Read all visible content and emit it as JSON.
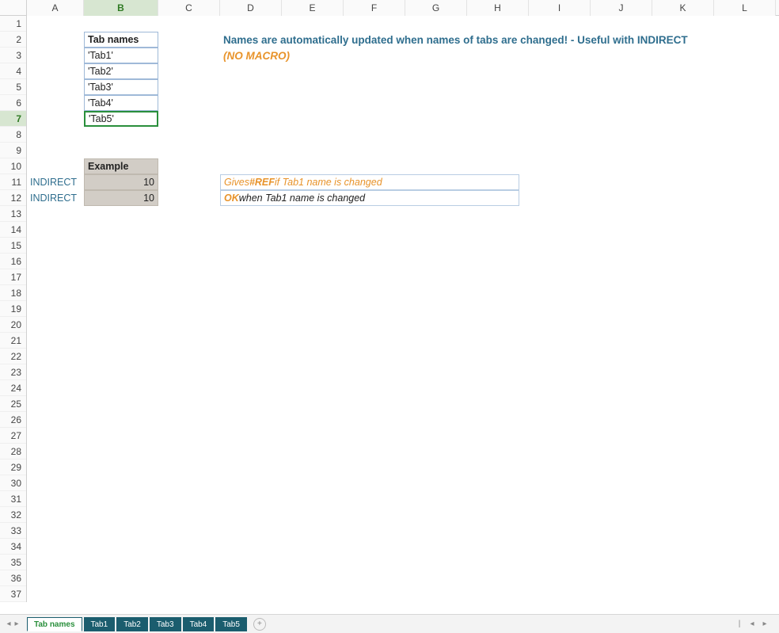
{
  "columns": [
    "A",
    "B",
    "C",
    "D",
    "E",
    "F",
    "G",
    "H",
    "I",
    "J",
    "K",
    "L"
  ],
  "selectedColumn": "B",
  "rows": 37,
  "selectedRow": 7,
  "tabNames": {
    "header": "Tab names",
    "items": [
      "'Tab1'",
      "'Tab2'",
      "'Tab3'",
      "'Tab4'",
      "'Tab5'"
    ]
  },
  "headline": "Names are automatically updated when names of tabs are changed! - Useful with INDIRECT",
  "subheadline": "(NO MACRO)",
  "example": {
    "header": "Example",
    "rows": [
      {
        "label": "INDIRECT",
        "value": "10",
        "note_prefix": "Gives ",
        "note_accent": "#REF",
        "note_suffix": " if Tab1 name is changed"
      },
      {
        "label": "INDIRECT",
        "value": "10",
        "note_prefix": "",
        "note_accent": "OK",
        "note_suffix": "  when Tab1 name is changed"
      }
    ]
  },
  "sheetTabs": {
    "active": "Tab names",
    "others": [
      "Tab1",
      "Tab2",
      "Tab3",
      "Tab4",
      "Tab5"
    ]
  },
  "glyphs": {
    "plus": "+",
    "left": "◂",
    "right": "▸",
    "bar": "|"
  }
}
